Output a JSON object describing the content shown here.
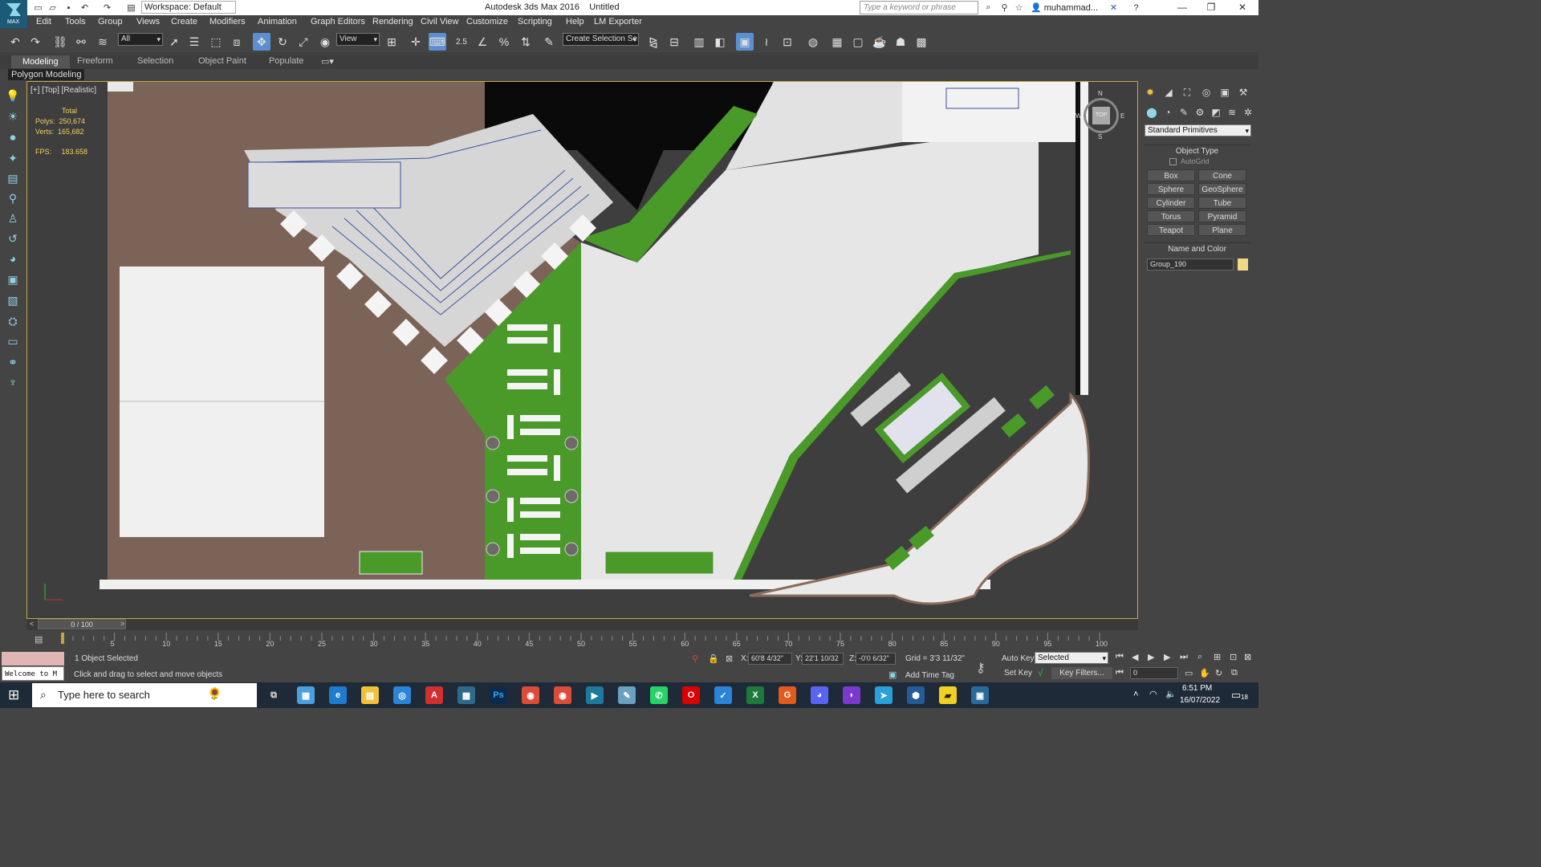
{
  "window": {
    "title": "Autodesk 3ds Max 2016",
    "document": "Untitled",
    "workspace": "Workspace: Default",
    "search_placeholder": "Type a keyword or phrase",
    "user": "muhammad...",
    "logo_text": "MAX"
  },
  "menu": [
    "Edit",
    "Tools",
    "Group",
    "Views",
    "Create",
    "Modifiers",
    "Animation",
    "Graph Editors",
    "Rendering",
    "Civil View",
    "Customize",
    "Scripting",
    "Help",
    "LM Exporter"
  ],
  "toolbar": {
    "selection_filter": "All",
    "reference_coord": "View",
    "snap_value": "2.5",
    "named_selection": "Create Selection Se"
  },
  "ribbon": {
    "tabs": [
      "Modeling",
      "Freeform",
      "Selection",
      "Object Paint",
      "Populate"
    ],
    "active": "Modeling",
    "panel_label": "Polygon Modeling"
  },
  "viewport": {
    "label": "[+] [Top] [Realistic]",
    "stats": {
      "header": "Total",
      "polys_label": "Polys:",
      "polys_value": "250,674",
      "verts_label": "Verts:",
      "verts_value": "165,682",
      "fps_label": "FPS:",
      "fps_value": "183.658"
    },
    "viewcube_label": "TOP",
    "compass": {
      "n": "N",
      "s": "S",
      "e": "E",
      "w": "W"
    }
  },
  "command_panel": {
    "category": "Standard Primitives",
    "object_type_header": "Object Type",
    "autogrid_label": "AutoGrid",
    "buttons": [
      "Box",
      "Cone",
      "Sphere",
      "GeoSphere",
      "Cylinder",
      "Tube",
      "Torus",
      "Pyramid",
      "Teapot",
      "Plane"
    ],
    "name_color_header": "Name and Color",
    "object_name": "Group_190",
    "object_color": "#f2d98a"
  },
  "timeline": {
    "frame_display": "0 / 100",
    "ticks": [
      "5",
      "10",
      "15",
      "20",
      "25",
      "30",
      "35",
      "40",
      "45",
      "50",
      "55",
      "60",
      "65",
      "70",
      "75",
      "80",
      "85",
      "90",
      "95",
      "100"
    ]
  },
  "status": {
    "maxscript": "Welcome to M",
    "selection_count": "1 Object Selected",
    "prompt": "Click and drag to select and move objects",
    "x_label": "X:",
    "x_value": "60'8 4/32\"",
    "y_label": "Y:",
    "y_value": "22'1 10/32",
    "z_label": "Z:",
    "z_value": "-0'0 6/32\"",
    "grid": "Grid = 3'3 11/32\"",
    "add_time_tag": "Add Time Tag",
    "auto_key": "Auto Key",
    "set_key": "Set Key",
    "key_mode": "Selected",
    "key_filters": "Key Filters...",
    "current_frame": "0"
  },
  "taskbar": {
    "search_placeholder": "Type here to search",
    "time": "6:51 PM",
    "date": "16/07/2022",
    "notification_count": "18"
  }
}
